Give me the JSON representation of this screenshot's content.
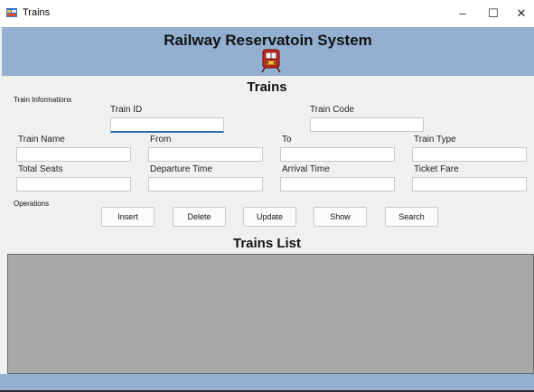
{
  "window": {
    "title": "Trains",
    "controls": {
      "minimize": "–",
      "maximize": "☐",
      "close": "✕"
    }
  },
  "header": {
    "title": "Railway Reservatoin System",
    "icon": "train-icon"
  },
  "section_title": "Trains",
  "train_info": {
    "group_label": "Train Informations",
    "fields": {
      "train_id": {
        "label": "Train ID",
        "value": ""
      },
      "train_code": {
        "label": "Train Code",
        "value": ""
      },
      "train_name": {
        "label": "Train Name",
        "value": ""
      },
      "from": {
        "label": "From",
        "value": ""
      },
      "to": {
        "label": "To",
        "value": ""
      },
      "train_type": {
        "label": "Train Type",
        "value": ""
      },
      "total_seats": {
        "label": "Total Seats",
        "value": ""
      },
      "departure_time": {
        "label": "Departure Time",
        "value": ""
      },
      "arrival_time": {
        "label": "Arrival Time",
        "value": ""
      },
      "ticket_fare": {
        "label": "Ticket Fare",
        "value": ""
      }
    }
  },
  "operations": {
    "group_label": "Operations",
    "buttons": {
      "insert": "Insert",
      "delete": "Delete",
      "update": "Update",
      "show": "Show",
      "search": "Search"
    }
  },
  "list_title": "Trains List",
  "colors": {
    "header_bg": "#93b0d1",
    "grid_bg": "#a9a9a9",
    "focus_accent": "#2b6cb0"
  }
}
